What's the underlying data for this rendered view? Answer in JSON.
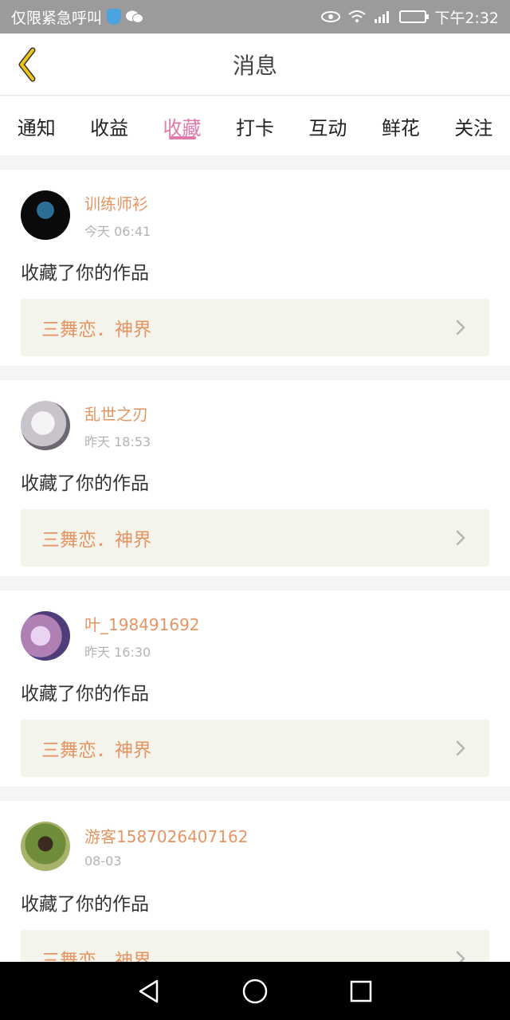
{
  "status_bar": {
    "left_text": "仅限紧急呼叫",
    "time": "下午2:32",
    "icons": [
      "shield-icon",
      "wechat-icon",
      "eye-icon",
      "wifi-icon",
      "signal-icon",
      "battery-icon"
    ]
  },
  "header": {
    "title": "消息",
    "back_icon": "chevron-left-icon"
  },
  "tabs": [
    {
      "label": "通知",
      "active": false
    },
    {
      "label": "收益",
      "active": false
    },
    {
      "label": "收藏",
      "active": true
    },
    {
      "label": "打卡",
      "active": false
    },
    {
      "label": "互动",
      "active": false
    },
    {
      "label": "鲜花",
      "active": false
    },
    {
      "label": "关注",
      "active": false
    }
  ],
  "items": [
    {
      "user": "训练师衫",
      "time": "今天 06:41",
      "action": "收藏了你的作品",
      "work": "三舞恋．神界"
    },
    {
      "user": "乱世之刃",
      "time": "昨天 18:53",
      "action": "收藏了你的作品",
      "work": "三舞恋．神界"
    },
    {
      "user": "叶_198491692",
      "time": "昨天 16:30",
      "action": "收藏了你的作品",
      "work": "三舞恋．神界"
    },
    {
      "user": "游客1587026407162",
      "time": "08-03",
      "action": "收藏了你的作品",
      "work": "三舞恋．神界"
    }
  ],
  "colors": {
    "accent_pink": "#e07aab",
    "username_orange": "#e59562",
    "work_bg": "#f4f3ec",
    "back_icon": "#f0c419"
  },
  "nav_bar": {
    "icons": [
      "back-triangle-icon",
      "home-circle-icon",
      "recents-square-icon"
    ]
  }
}
